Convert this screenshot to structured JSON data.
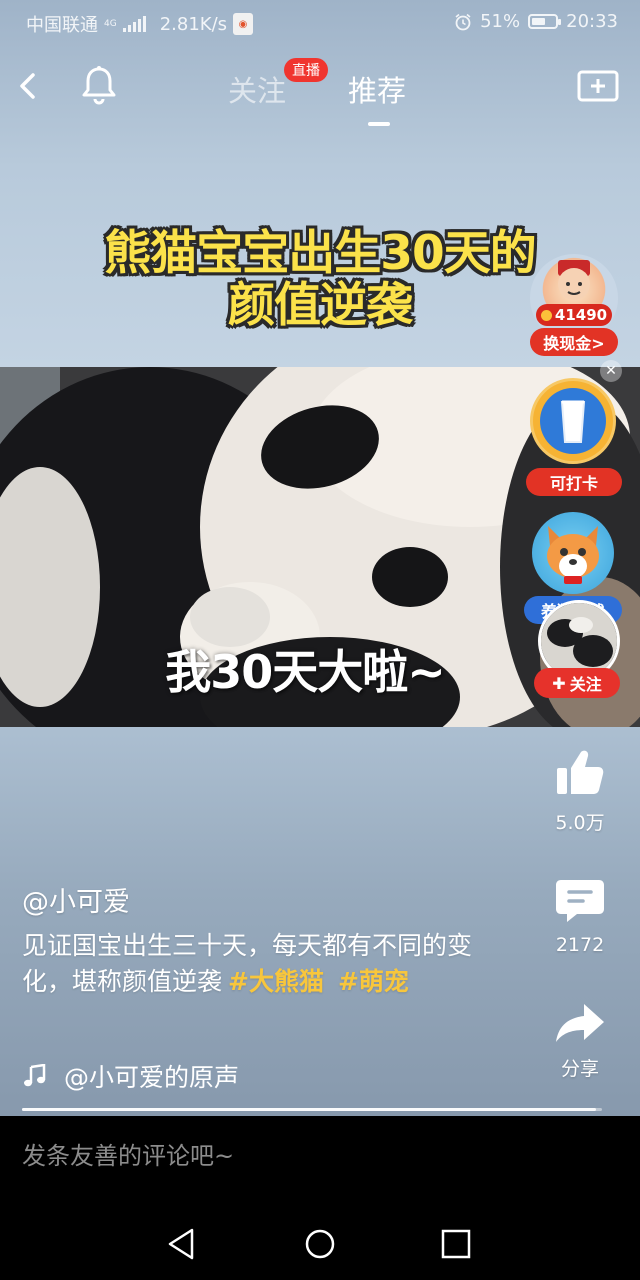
{
  "status_bar": {
    "carrier": "中国联通",
    "network_type": "4G",
    "speed": "2.81K/s",
    "battery_percent": "51%",
    "time": "20:33"
  },
  "top_nav": {
    "tab_follow": "关注",
    "live_badge": "直播",
    "tab_recommend": "推荐"
  },
  "video": {
    "title_line1": "熊猫宝宝出生30天的",
    "title_line2": "颜值逆袭",
    "caption": "我30天大啦~"
  },
  "widgets": {
    "coin_amount": "41490",
    "cash_button": "换现金>",
    "checkin_label": "可打卡",
    "dog_label": "养狗赚钱",
    "follow_label": "关注"
  },
  "actions": {
    "like_count": "5.0万",
    "comment_count": "2172",
    "share_label": "分享"
  },
  "post": {
    "author": "@小可爱",
    "description": "见证国宝出生三十天，每天都有不同的变化，堪称颜值逆袭",
    "hashtags": [
      "#大熊猫",
      "#萌宠"
    ],
    "music": "@小可爱的原声",
    "progress": 0.99
  },
  "comment_bar": {
    "placeholder": "发条友善的评论吧~"
  },
  "icons": {
    "back": "chevron-left-icon",
    "bell": "bell-icon",
    "record": "video-plus-icon",
    "like": "thumbs-up-icon",
    "comment": "comment-bubble-icon",
    "share": "share-arrow-icon",
    "music": "music-note-icon"
  },
  "colors": {
    "hashtag": "#f8c63c",
    "badge_red": "#e23325",
    "title_yellow": "#fbe24a"
  }
}
